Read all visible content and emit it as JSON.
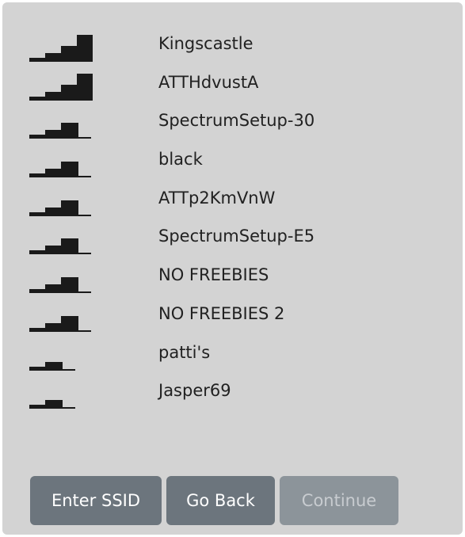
{
  "networks": [
    {
      "ssid": "Kingscastle",
      "signal_bars": 4,
      "signal_icon": "wifi-signal-4-icon"
    },
    {
      "ssid": "ATTHdvustA",
      "signal_bars": 4,
      "signal_icon": "wifi-signal-4-icon"
    },
    {
      "ssid": "SpectrumSetup-30",
      "signal_bars": 3,
      "signal_icon": "wifi-signal-3-icon"
    },
    {
      "ssid": "black",
      "signal_bars": 3,
      "signal_icon": "wifi-signal-3-icon"
    },
    {
      "ssid": "ATTp2KmVnW",
      "signal_bars": 3,
      "signal_icon": "wifi-signal-3-icon"
    },
    {
      "ssid": "SpectrumSetup-E5",
      "signal_bars": 3,
      "signal_icon": "wifi-signal-3-icon"
    },
    {
      "ssid": "NO FREEBIES",
      "signal_bars": 3,
      "signal_icon": "wifi-signal-3-icon"
    },
    {
      "ssid": "NO FREEBIES 2",
      "signal_bars": 3,
      "signal_icon": "wifi-signal-3-icon"
    },
    {
      "ssid": "patti's",
      "signal_bars": 2,
      "signal_icon": "wifi-signal-2-icon"
    },
    {
      "ssid": "Jasper69",
      "signal_bars": 2,
      "signal_icon": "wifi-signal-2-icon"
    }
  ],
  "buttons": {
    "enter_ssid": "Enter SSID",
    "go_back": "Go Back",
    "continue": "Continue",
    "continue_enabled": false
  },
  "colors": {
    "panel_background": "#d3d3d3",
    "signal_fill": "#1a1a1a",
    "button_background": "#6c757d",
    "button_disabled_background": "#8c949a"
  }
}
